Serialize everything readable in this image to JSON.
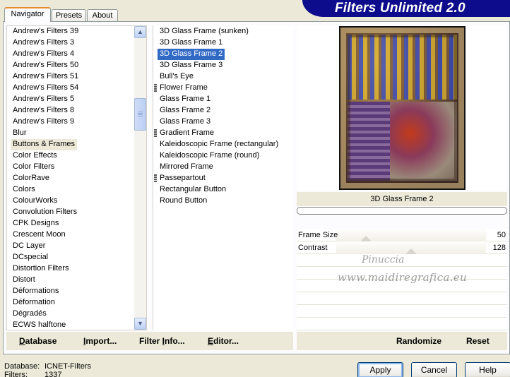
{
  "tabs": [
    {
      "label": "Navigator",
      "active": true
    },
    {
      "label": "Presets",
      "active": false
    },
    {
      "label": "About",
      "active": false
    }
  ],
  "banner": {
    "title": "Filters Unlimited 2.0"
  },
  "categories": {
    "items": [
      "Andrew's Filters 39",
      "Andrew's Filters 3",
      "Andrew's Filters 4",
      "Andrew's Filters 50",
      "Andrew's Filters 51",
      "Andrew's Filters 54",
      "Andrew's Filters 5",
      "Andrew's Filters 8",
      "Andrew's Filters 9",
      "Blur",
      "Buttons & Frames",
      "Color Effects",
      "Color Filters",
      "ColorRave",
      "Colors",
      "ColourWorks",
      "Convolution Filters",
      "CPK Designs",
      "Crescent Moon",
      "DC Layer",
      "DCspecial",
      "Distortion Filters",
      "Distort",
      "Déformations",
      "Déformation",
      "Dégradés",
      "ECWS halftone"
    ],
    "selected": "Buttons & Frames"
  },
  "filters": {
    "items": [
      {
        "label": "3D Glass Frame (sunken)",
        "grip": false
      },
      {
        "label": "3D Glass Frame 1",
        "grip": false
      },
      {
        "label": "3D Glass Frame 2",
        "grip": false
      },
      {
        "label": "3D Glass Frame 3",
        "grip": false
      },
      {
        "label": "Bull's Eye",
        "grip": false
      },
      {
        "label": "Flower Frame",
        "grip": true
      },
      {
        "label": "Glass Frame 1",
        "grip": false
      },
      {
        "label": "Glass Frame 2",
        "grip": false
      },
      {
        "label": "Glass Frame 3",
        "grip": false
      },
      {
        "label": "Gradient Frame",
        "grip": true
      },
      {
        "label": "Kaleidoscopic Frame (rectangular)",
        "grip": false
      },
      {
        "label": "Kaleidoscopic Frame (round)",
        "grip": false
      },
      {
        "label": "Mirrored Frame",
        "grip": false
      },
      {
        "label": "Passepartout",
        "grip": true
      },
      {
        "label": "Rectangular Button",
        "grip": false
      },
      {
        "label": "Round Button",
        "grip": false
      }
    ],
    "selected": "3D Glass Frame 2"
  },
  "preview": {
    "filter_name": "3D Glass Frame 2",
    "progress": 0
  },
  "params": [
    {
      "label": "Frame Size",
      "value": "50",
      "level": 0.2
    },
    {
      "label": "Contrast",
      "value": "128",
      "level": 0.5
    }
  ],
  "watermark": {
    "line1": "Pinuccia",
    "line2": "www.maidiregrafica.eu"
  },
  "toolbar": {
    "database": {
      "u": "D",
      "rest": "atabase"
    },
    "import": {
      "u": "I",
      "rest": "mport..."
    },
    "filter_info": {
      "pre": "Filter ",
      "u": "I",
      "rest": "nfo..."
    },
    "editor": {
      "u": "E",
      "rest": "ditor..."
    },
    "randomize": "Randomize",
    "reset": "Reset"
  },
  "status": {
    "database_label": "Database:",
    "database_value": "ICNET-Filters",
    "filters_label": "Filters:",
    "filters_value": "1337"
  },
  "buttons": {
    "apply": "Apply",
    "cancel": "Cancel",
    "help": "Help"
  }
}
